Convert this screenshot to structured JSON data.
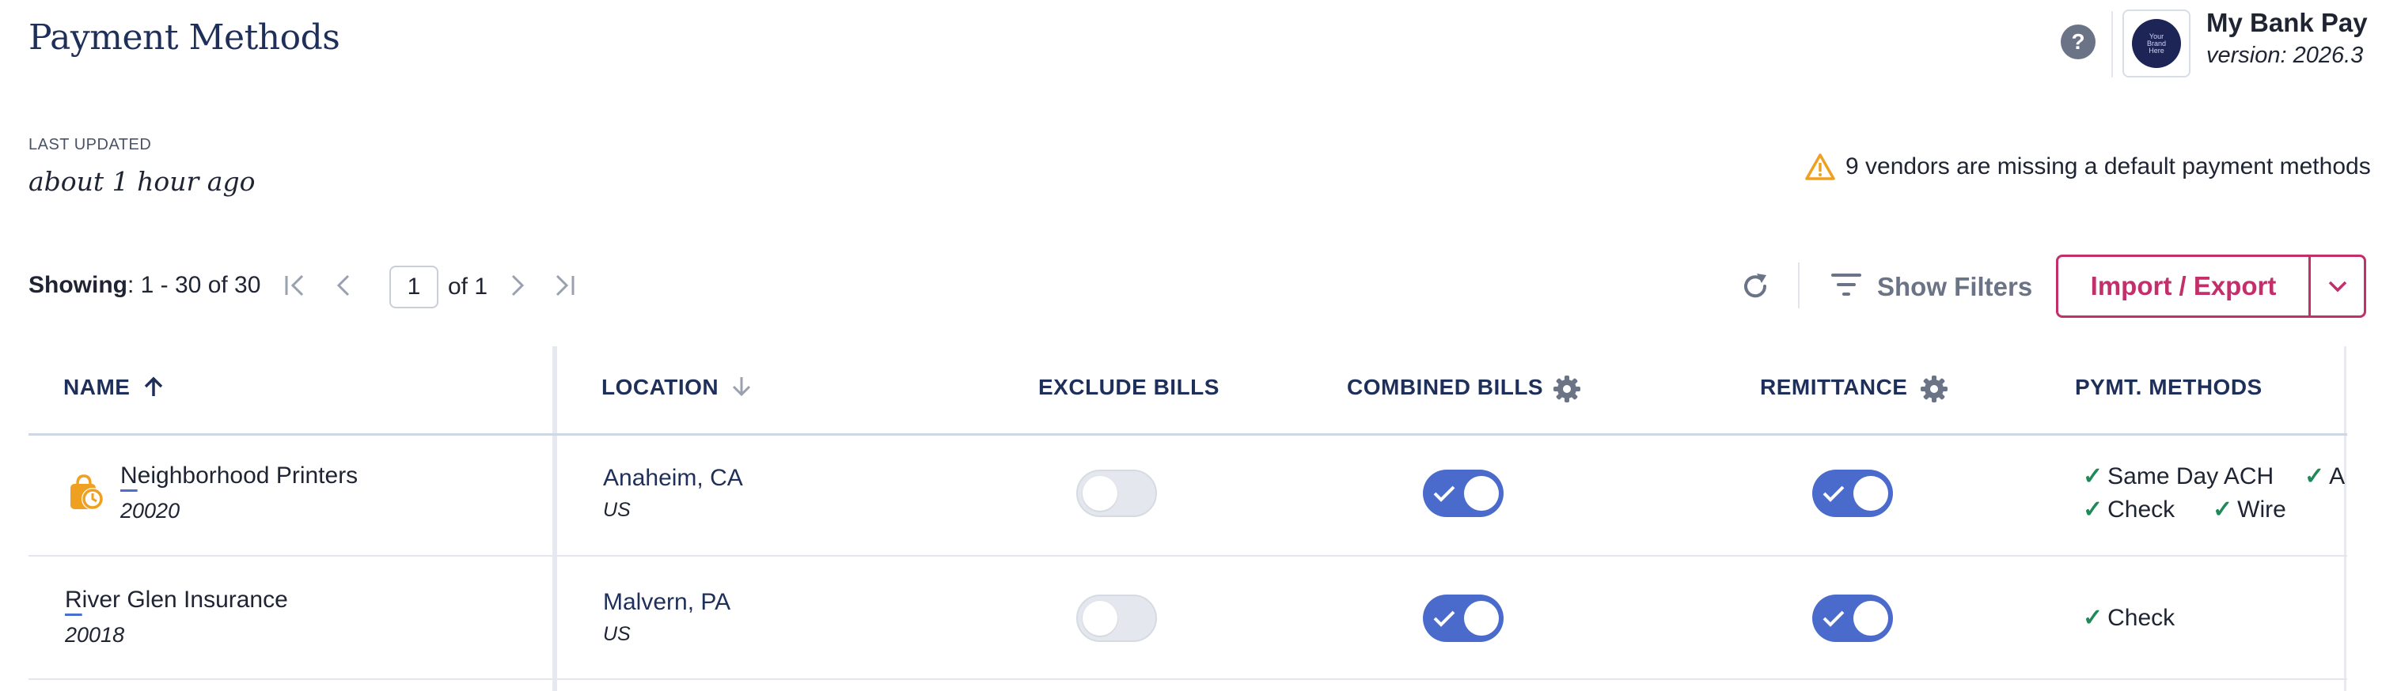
{
  "header": {
    "title": "Payment Methods",
    "app_name": "My Bank Pay",
    "app_version": "version: 2026.3",
    "brand_logo_text": [
      "Your",
      "Brand",
      "Here"
    ]
  },
  "last_updated": {
    "label": "LAST UPDATED",
    "value": "about 1 hour ago"
  },
  "alert": {
    "text": "9 vendors are missing a default payment methods",
    "color": "#f0a020"
  },
  "pager": {
    "showing_label": "Showing",
    "showing_range": ": 1 - 30 of 30",
    "page_value": "1",
    "page_of": "of 1"
  },
  "toolbar": {
    "filters_label": "Show Filters",
    "import_export_label": "Import / Export",
    "accent_color": "#c2306b"
  },
  "table": {
    "columns": {
      "name": "NAME",
      "location": "LOCATION",
      "exclude_bills": "EXCLUDE BILLS",
      "combined_bills": "COMBINED BILLS",
      "remittance": "REMITTANCE",
      "pymt_methods": "PYMT. METHODS"
    },
    "sort": {
      "name": "ascending",
      "location": "descending"
    },
    "rows": [
      {
        "name_first": "N",
        "name_rest": "eighborhood Printers",
        "id": "20020",
        "status_icon": "pending-clock-icon",
        "city": "Anaheim, CA",
        "country": "US",
        "exclude_bills": false,
        "combined_bills": true,
        "remittance": true,
        "methods": [
          "Same Day ACH",
          "A",
          "Check",
          "Wire"
        ]
      },
      {
        "name_first": "R",
        "name_rest": "iver Glen Insurance",
        "id": "20018",
        "city": "Malvern, PA",
        "country": "US",
        "exclude_bills": false,
        "combined_bills": true,
        "remittance": true,
        "methods": [
          "Check"
        ]
      }
    ]
  },
  "colors": {
    "title": "#1e2f5a",
    "toggle_on": "#4a6bcc",
    "check": "#1e8a5a",
    "status_icon": "#f0a020"
  }
}
